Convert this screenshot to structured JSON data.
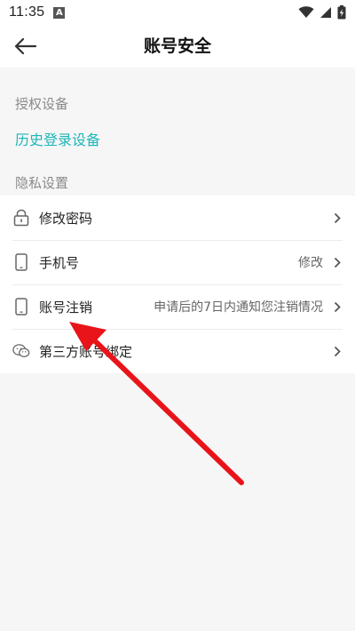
{
  "status_bar": {
    "time": "11:35",
    "notification_badge": "A",
    "icons": [
      "wifi-icon",
      "signal-icon",
      "battery-charging-icon"
    ]
  },
  "header": {
    "title": "账号安全",
    "back_icon": "arrow-left-icon"
  },
  "authorized_devices": {
    "section_label": "授权设备",
    "link_label": "历史登录设备"
  },
  "privacy": {
    "section_label": "隐私设置",
    "items": [
      {
        "label": "修改密码",
        "value": "",
        "icon": "lock-icon"
      },
      {
        "label": "手机号",
        "value": "修改",
        "icon": "phone-icon"
      },
      {
        "label": "账号注销",
        "value": "申请后的7日内通知您注销情况",
        "icon": "phone-icon"
      },
      {
        "label": "第三方账号绑定",
        "value": "",
        "icon": "wechat-icon"
      }
    ]
  },
  "annotation": {
    "arrow_color": "#e8141a"
  },
  "colors": {
    "accent": "#1fb5b8",
    "background": "#f6f6f6"
  }
}
